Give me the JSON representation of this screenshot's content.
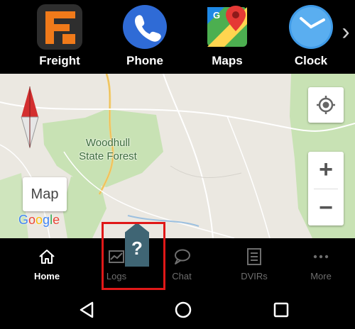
{
  "dock": {
    "apps": [
      {
        "label": "Freight",
        "icon": "freight-app-icon"
      },
      {
        "label": "Phone",
        "icon": "phone-icon"
      },
      {
        "label": "Maps",
        "icon": "maps-icon"
      },
      {
        "label": "Clock",
        "icon": "clock-icon"
      }
    ],
    "more_glyph": "›"
  },
  "map": {
    "place_label_line1": "Woodhull",
    "place_label_line2": "State Forest",
    "map_toggle_label": "Map",
    "zoom_in": "+",
    "zoom_out": "−",
    "attribution": [
      "G",
      "o",
      "o",
      "g",
      "l",
      "e"
    ]
  },
  "tabs": [
    {
      "label": "Home",
      "icon": "home-icon",
      "active": true
    },
    {
      "label": "Logs",
      "icon": "logs-icon",
      "active": false
    },
    {
      "label": "Chat",
      "icon": "chat-icon",
      "active": false
    },
    {
      "label": "DVIRs",
      "icon": "dvirs-icon",
      "active": false
    },
    {
      "label": "More",
      "icon": "more-dots-icon",
      "active": false
    }
  ],
  "help_badge": "?",
  "colors": {
    "highlight": "#e01818",
    "help_badge": "#3f6574",
    "forest": "#c8e2b4",
    "map_bg": "#ebe8e1"
  }
}
